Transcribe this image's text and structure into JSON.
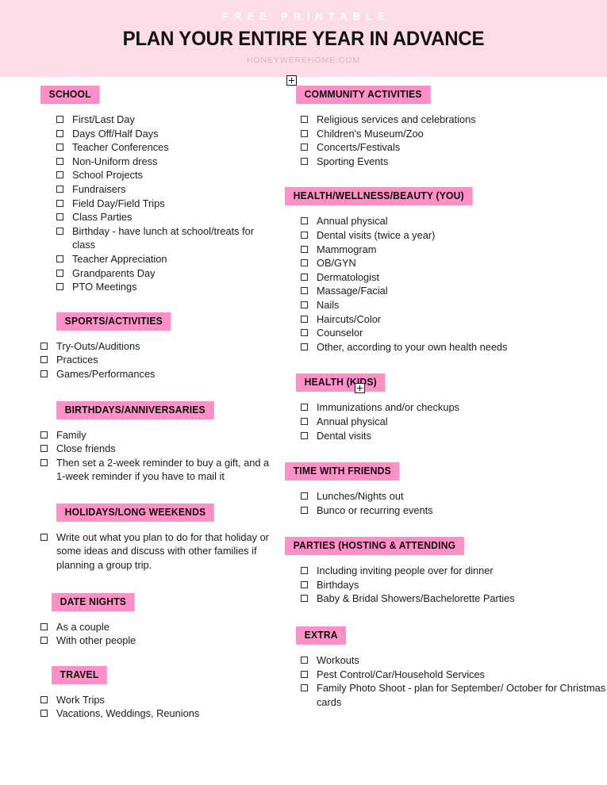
{
  "header": {
    "kicker": "FREE PRINTABLE",
    "title": "PLAN YOUR ENTIRE YEAR IN ADVANCE",
    "byline": "HONEYWEREHOME.COM"
  },
  "colors": {
    "header_band": "#FCDCE8",
    "badge_pink": "#FF8FC7",
    "text": "#1B1B1B",
    "byline": "#D8B6C2",
    "kicker": "#FFFFFF"
  },
  "markers": [
    {
      "name": "page-marker-top"
    },
    {
      "name": "page-marker-health-kids"
    }
  ],
  "left_column": [
    {
      "title": "SCHOOL",
      "items": [
        "First/Last Day",
        "Days Off/Half Days",
        "Teacher Conferences",
        "Non-Uniform dress",
        "School Projects",
        "Fundraisers",
        "Field Day/Field Trips",
        "Class Parties",
        "Birthday - have lunch at school/treats for class",
        "Teacher Appreciation",
        "Grandparents Day",
        "PTO Meetings"
      ]
    },
    {
      "title": "SPORTS/ACTIVITIES",
      "items": [
        "Try-Outs/Auditions",
        "Practices",
        "Games/Performances"
      ]
    },
    {
      "title": "BIRTHDAYS/ANNIVERSARIES",
      "items": [
        "Family",
        "Close friends",
        "Then set a 2-week reminder to buy a gift, and a 1-week reminder if you have to mail it"
      ]
    },
    {
      "title": "HOLIDAYS/LONG WEEKENDS",
      "items": [
        "Write out what you plan to do for that holiday or some ideas and discuss with other families if planning a group trip."
      ]
    },
    {
      "title": "DATE NIGHTS",
      "items": [
        "As a couple",
        "With other people"
      ]
    },
    {
      "title": "TRAVEL",
      "items": [
        "Work Trips",
        "Vacations, Weddings, Reunions"
      ]
    }
  ],
  "right_column": [
    {
      "title": "COMMUNITY ACTIVITIES",
      "items": [
        "Religious services and celebrations",
        "Children's Museum/Zoo",
        "Concerts/Festivals",
        "Sporting Events"
      ]
    },
    {
      "title": "HEALTH/WELLNESS/BEAUTY (YOU)",
      "items": [
        "Annual physical",
        "Dental visits (twice a year)",
        "Mammogram",
        "OB/GYN",
        "Dermatologist",
        "Massage/Facial",
        "Nails",
        "Haircuts/Color",
        "Counselor",
        "Other, according to your own health needs"
      ]
    },
    {
      "title": "HEALTH (KIDS)",
      "items": [
        "Immunizations and/or checkups",
        "Annual physical",
        "Dental visits"
      ]
    },
    {
      "title": "TIME WITH FRIENDS",
      "items": [
        "Lunches/Nights out",
        "Bunco or recurring events"
      ]
    },
    {
      "title": "PARTIES (HOSTING & ATTENDING",
      "items": [
        "Including inviting people over for dinner",
        "Birthdays",
        "Baby & Bridal Showers/Bachelorette Parties"
      ]
    },
    {
      "title": "EXTRA",
      "items": [
        "Workouts",
        "Pest Control/Car/Household Services",
        "Family Photo Shoot - plan for September/ October for Christmas cards"
      ]
    }
  ]
}
